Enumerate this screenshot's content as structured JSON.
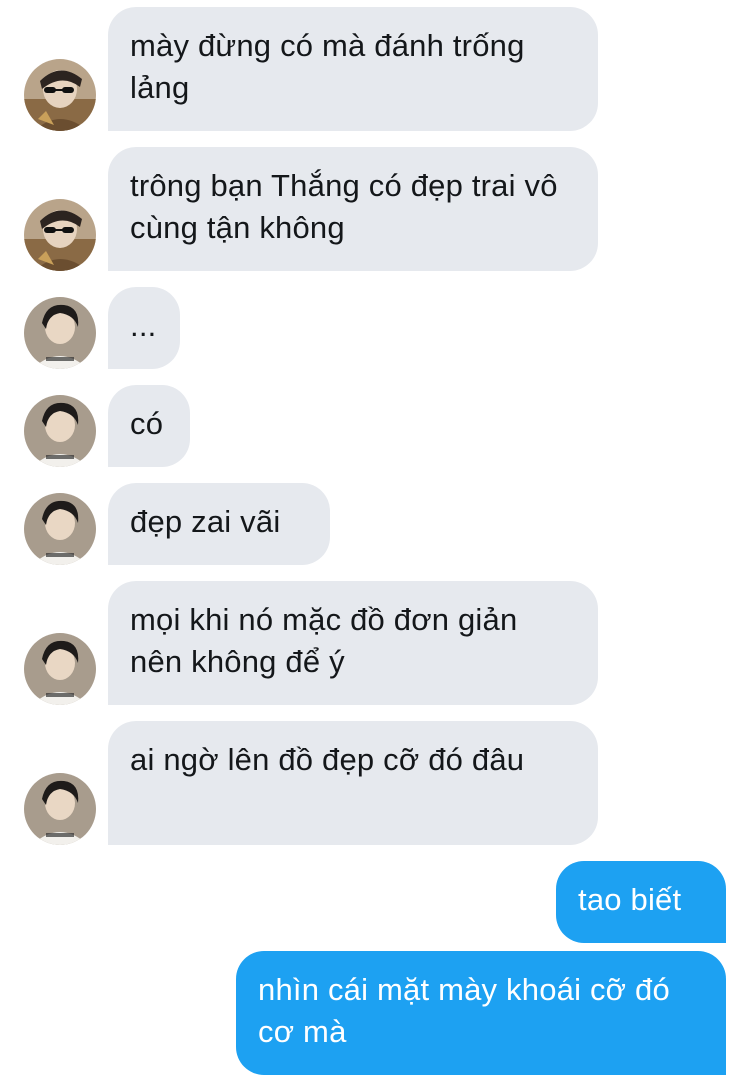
{
  "conversation": {
    "messages": [
      {
        "text": "mày đừng có mà đánh trống lảng",
        "sender": "friend-a",
        "direction": "incoming"
      },
      {
        "text": "trông bạn Thắng có đẹp trai vô cùng tận không",
        "sender": "friend-a",
        "direction": "incoming"
      },
      {
        "text": "...",
        "sender": "friend-b",
        "direction": "incoming"
      },
      {
        "text": "có",
        "sender": "friend-b",
        "direction": "incoming"
      },
      {
        "text": "đẹp zai vãi",
        "sender": "friend-b",
        "direction": "incoming"
      },
      {
        "text": "mọi khi nó mặc đồ đơn giản nên không để ý",
        "sender": "friend-b",
        "direction": "incoming"
      },
      {
        "text": "ai ngờ lên đồ đẹp cỡ đó đâu",
        "sender": "friend-b",
        "direction": "incoming"
      },
      {
        "text": "tao biết",
        "sender": "me",
        "direction": "outgoing"
      },
      {
        "text": "nhìn cái mặt mày khoái cỡ đó cơ mà",
        "sender": "me",
        "direction": "outgoing"
      }
    ],
    "avatars": {
      "friend-a": {
        "icon": "sunglasses-person-avatar"
      },
      "friend-b": {
        "icon": "person-white-shirt-avatar",
        "shirt_print": "COVERNAT"
      }
    }
  },
  "colors": {
    "incoming_bubble": "#e6e9ee",
    "incoming_text": "#14171a",
    "outgoing_bubble": "#1da1f2",
    "outgoing_text": "#ffffff"
  }
}
